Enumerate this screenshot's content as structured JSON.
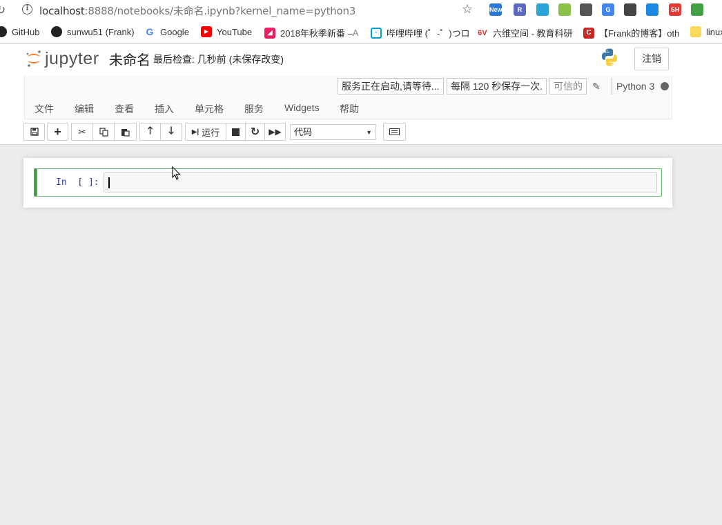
{
  "browser": {
    "url_host": "localhost",
    "url_rest": ":8888/notebooks/未命名.ipynb?kernel_name=python3",
    "extensions": [
      {
        "name": "new-extension-icon",
        "label": "New",
        "color": "#2a78d6"
      },
      {
        "name": "r-extension-icon",
        "label": "R",
        "color": "#5c6bc0"
      },
      {
        "name": "tab-extension-icon",
        "label": "",
        "color": "#29a3d8"
      },
      {
        "name": "circle-extension-icon",
        "label": "",
        "color": "#8bc34a"
      },
      {
        "name": "bulb-extension-icon",
        "label": "",
        "color": "#555555"
      },
      {
        "name": "translate-extension-icon",
        "label": "G",
        "color": "#4285f4"
      },
      {
        "name": "phone-extension-icon",
        "label": "",
        "color": "#444444"
      },
      {
        "name": "layers-extension-icon",
        "label": "",
        "color": "#1e88e5"
      },
      {
        "name": "sh-extension-icon",
        "label": "SH",
        "color": "#e53935"
      },
      {
        "name": "chrome-extension-icon",
        "label": "",
        "color": "#43a047"
      }
    ],
    "bookmarks": [
      {
        "label": "GitHub",
        "icon": "github-icon",
        "color": "#222222"
      },
      {
        "label": "sunwu51 (Frank)",
        "icon": "github-icon",
        "color": "#222222"
      },
      {
        "label": "Google",
        "icon": "google-icon",
        "color": "#4285f4"
      },
      {
        "label": "YouTube",
        "icon": "youtube-icon",
        "color": "#ff0000"
      },
      {
        "label": "2018年秋季新番 –",
        "dim": " A",
        "icon": "anime-icon",
        "color": "#e91e63"
      },
      {
        "label": "哔哩哔哩 (゜-゜)つロ",
        "icon": "bilibili-icon",
        "color": "#00a1d6"
      },
      {
        "label": "六维空间 - 教育科研",
        "icon": "6v-icon",
        "color": "#d32f2f"
      },
      {
        "label": "【Frank的博客】oth",
        "icon": "blog-icon",
        "color": "#c62828"
      },
      {
        "label": "linux",
        "icon": "folder-icon",
        "color": "#f9d85c"
      }
    ]
  },
  "header": {
    "logo_text": "jupyter",
    "notebook_name": "未命名",
    "checkpoint": "最后检查: 几秒前  (未保存改变)",
    "logout_label": "注销"
  },
  "indicators": {
    "kernel_status": "服务正在启动,请等待...",
    "autosave": "每隔 120 秒保存一次.",
    "trusted": "可信的",
    "kernel_name": "Python 3"
  },
  "menu": [
    "文件",
    "编辑",
    "查看",
    "插入",
    "单元格",
    "服务",
    "Widgets",
    "帮助"
  ],
  "toolbar": {
    "run_label": "运行",
    "cell_type": "代码"
  },
  "cell": {
    "prompt": "In  [ ]:",
    "source": ""
  }
}
